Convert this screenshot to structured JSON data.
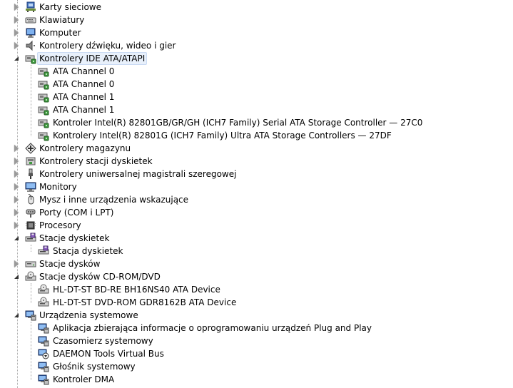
{
  "colors": {
    "selection_bg": "#e8f0fb",
    "selection_border": "#c9daf3"
  },
  "tree": {
    "nodes": [
      {
        "label": "Karty sieciowe",
        "icon": "network-adapter-icon",
        "level": 0,
        "state": "collapsed"
      },
      {
        "label": "Klawiatury",
        "icon": "keyboard-icon",
        "level": 0,
        "state": "collapsed"
      },
      {
        "label": "Komputer",
        "icon": "computer-icon",
        "level": 0,
        "state": "collapsed"
      },
      {
        "label": "Kontrolery dźwięku, wideo i gier",
        "icon": "speaker-icon",
        "level": 0,
        "state": "collapsed"
      },
      {
        "label": "Kontrolery IDE ATA/ATAPI",
        "icon": "ide-controller-icon",
        "level": 0,
        "state": "expanded",
        "selected": true
      },
      {
        "label": "ATA Channel 0",
        "icon": "ide-controller-icon",
        "level": 1
      },
      {
        "label": "ATA Channel 0",
        "icon": "ide-controller-icon",
        "level": 1
      },
      {
        "label": "ATA Channel 1",
        "icon": "ide-controller-icon",
        "level": 1
      },
      {
        "label": "ATA Channel 1",
        "icon": "ide-controller-icon",
        "level": 1
      },
      {
        "label": "Kontroler Intel(R) 82801GB/GR/GH (ICH7 Family) Serial ATA Storage Controller — 27C0",
        "icon": "ide-controller-icon",
        "level": 1
      },
      {
        "label": "Kontrolery Intel(R) 82801G (ICH7 Family) Ultra ATA Storage Controllers — 27DF",
        "icon": "ide-controller-icon",
        "level": 1
      },
      {
        "label": "Kontrolery magazynu",
        "icon": "storage-controller-icon",
        "level": 0,
        "state": "collapsed"
      },
      {
        "label": "Kontrolery stacji dyskietek",
        "icon": "floppy-controller-icon",
        "level": 0,
        "state": "collapsed"
      },
      {
        "label": "Kontrolery uniwersalnej magistrali szeregowej",
        "icon": "usb-icon",
        "level": 0,
        "state": "collapsed"
      },
      {
        "label": "Monitory",
        "icon": "monitor-icon",
        "level": 0,
        "state": "collapsed"
      },
      {
        "label": "Mysz i inne urządzenia wskazujące",
        "icon": "mouse-icon",
        "level": 0,
        "state": "collapsed"
      },
      {
        "label": "Porty (COM i LPT)",
        "icon": "port-icon",
        "level": 0,
        "state": "collapsed"
      },
      {
        "label": "Procesory",
        "icon": "processor-icon",
        "level": 0,
        "state": "collapsed"
      },
      {
        "label": "Stacje dyskietek",
        "icon": "floppy-drive-icon",
        "level": 0,
        "state": "expanded"
      },
      {
        "label": "Stacja dyskietek",
        "icon": "floppy-drive-icon",
        "level": 1
      },
      {
        "label": "Stacje dysków",
        "icon": "disk-drive-icon",
        "level": 0,
        "state": "collapsed"
      },
      {
        "label": "Stacje dysków CD-ROM/DVD",
        "icon": "cdrom-icon",
        "level": 0,
        "state": "expanded"
      },
      {
        "label": "HL-DT-ST BD-RE  BH16NS40 ATA Device",
        "icon": "cdrom-icon",
        "level": 1
      },
      {
        "label": "HL-DT-ST DVD-ROM GDR8162B ATA Device",
        "icon": "cdrom-icon",
        "level": 1
      },
      {
        "label": "Urządzenia systemowe",
        "icon": "system-device-icon",
        "level": 0,
        "state": "expanded"
      },
      {
        "label": "Aplikacja zbierająca informacje o oprogramowaniu urządzeń Plug and Play",
        "icon": "system-device-icon",
        "level": 1
      },
      {
        "label": "Czasomierz systemowy",
        "icon": "system-device-icon",
        "level": 1
      },
      {
        "label": "DAEMON Tools Virtual Bus",
        "icon": "daemon-tools-icon",
        "level": 1
      },
      {
        "label": "Głośnik systemowy",
        "icon": "system-device-icon",
        "level": 1
      },
      {
        "label": "Kontroler DMA",
        "icon": "system-device-icon",
        "level": 1
      }
    ]
  }
}
